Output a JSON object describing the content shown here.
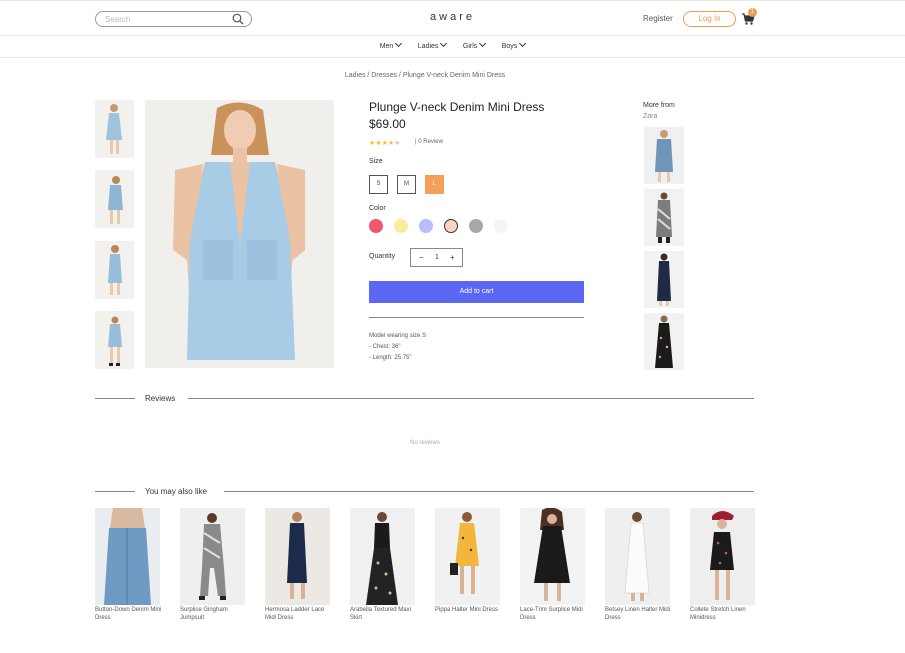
{
  "header": {
    "search_placeholder": "Search",
    "logo": "aware",
    "register": "Register",
    "login": "Log In",
    "cart_count": "1"
  },
  "nav": {
    "items": [
      "Men",
      "Ladies",
      "Girls",
      "Boys"
    ]
  },
  "breadcrumb": "Ladies / Dresses / Plunge V-neck Denim Mini Dress",
  "product": {
    "title": "Plunge V-neck Denim Mini Dress",
    "price": "$69.00",
    "rating": 4,
    "review_count": "| 0 Review",
    "size_label": "Size",
    "sizes": [
      "S",
      "M",
      "L"
    ],
    "selected_size": "L",
    "color_label": "Color",
    "colors": [
      "#f2566b",
      "#f9ec9e",
      "#b9bdfb",
      "#fcd3c0",
      "#a8a8a8",
      "#f4f4f4"
    ],
    "selected_color": "#fcd3c0",
    "quantity_label": "Quantity",
    "quantity": "1",
    "add_to_cart": "Add to cart",
    "details": [
      "Model wearing size S",
      "- Chest: 36\"",
      "- Length: 25.75\""
    ]
  },
  "more_from": {
    "title": "More from",
    "brand": "Zara"
  },
  "reviews": {
    "title": "Reviews",
    "empty": "No reviews"
  },
  "also_like": {
    "title": "You may also like",
    "items": [
      {
        "name": "Button-Down Denim Mini Dress"
      },
      {
        "name": "Surplice Gingham Jumpsuit"
      },
      {
        "name": "Hermosa Ladder Lace Midi Dress"
      },
      {
        "name": "Arabella Textured Maxi Skirt"
      },
      {
        "name": "Pippa Halter Mini Dress"
      },
      {
        "name": "Lace-Trim Surplice Midi Dress"
      },
      {
        "name": "Betsey Linen Halter Midi Dress"
      },
      {
        "name": "Collete Stretch Linen Minidress"
      }
    ]
  },
  "colors": {
    "accent": "#f39a4c",
    "button": "#5b67f2",
    "star": "#f2c230"
  }
}
